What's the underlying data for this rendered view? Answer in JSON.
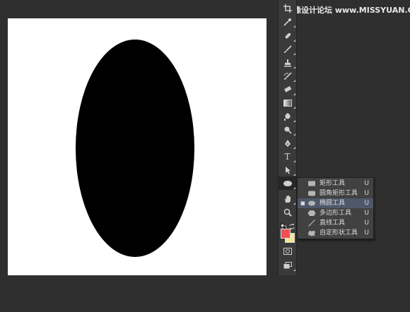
{
  "watermark": "思缘设计论坛 www.MISSYUAN.COM",
  "canvas": {
    "background": "#ffffff",
    "shape_fill": "#000000",
    "shape": "ellipse"
  },
  "toolbar": {
    "tools": [
      "crop-icon",
      "eyedropper-icon",
      "spot-healing-icon",
      "brush-icon",
      "clone-stamp-icon",
      "history-brush-icon",
      "eraser-icon",
      "gradient-icon",
      "blur-icon",
      "dodge-icon",
      "pen-icon",
      "type-icon",
      "path-selection-icon",
      "ellipse-tool-icon",
      "hand-icon",
      "zoom-icon",
      "quick-mask-icon",
      "screen-mode-icon"
    ],
    "type_label": "T",
    "foreground_color": "#f05050",
    "background_color": "#f7e58e"
  },
  "flyout": {
    "selected_index": 2,
    "bullet": "■",
    "items": [
      {
        "label": "矩形工具",
        "shortcut": "U",
        "icon": "rectangle-tool-icon"
      },
      {
        "label": "圆角矩形工具",
        "shortcut": "U",
        "icon": "rounded-rectangle-tool-icon"
      },
      {
        "label": "椭圆工具",
        "shortcut": "U",
        "icon": "ellipse-tool-icon"
      },
      {
        "label": "多边形工具",
        "shortcut": "U",
        "icon": "polygon-tool-icon"
      },
      {
        "label": "直线工具",
        "shortcut": "U",
        "icon": "line-tool-icon"
      },
      {
        "label": "自定形状工具",
        "shortcut": "U",
        "icon": "custom-shape-tool-icon"
      }
    ]
  }
}
